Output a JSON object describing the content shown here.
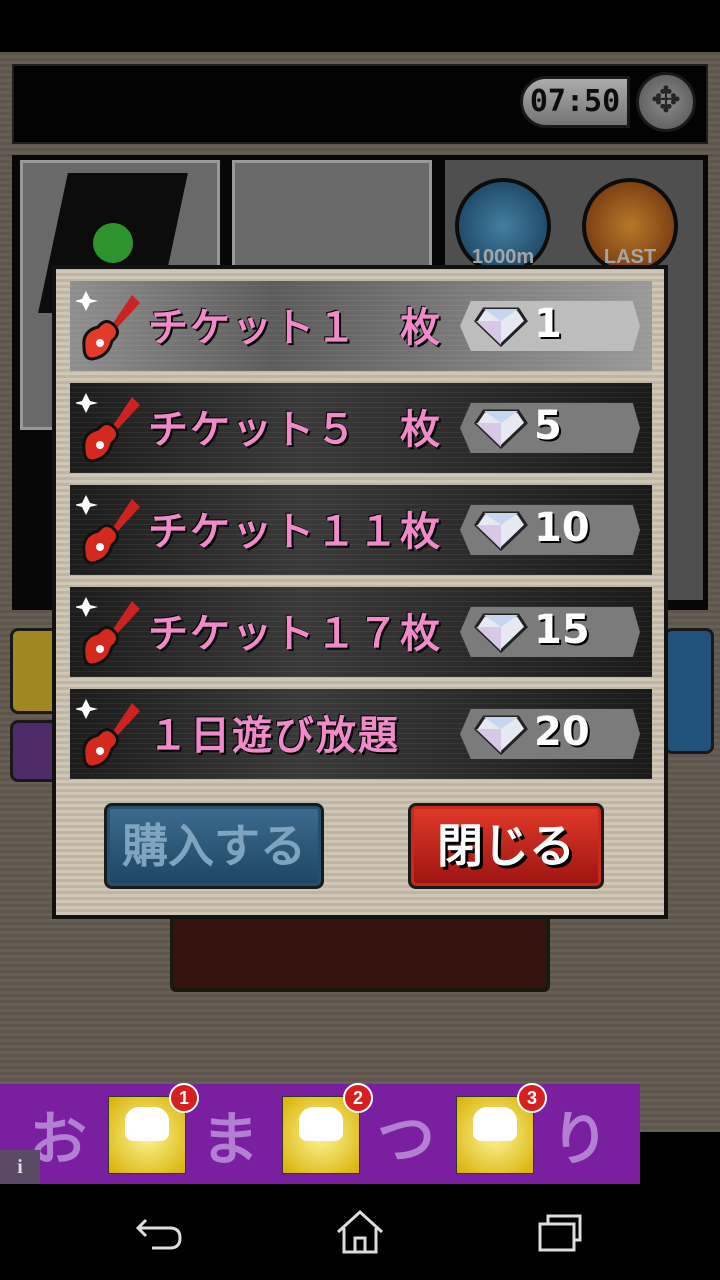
{
  "status": {
    "timer": "07:50"
  },
  "background": {
    "medals": [
      "1000m",
      "LAST"
    ],
    "start_button_label": ""
  },
  "shop_dialog": {
    "options": [
      {
        "label": "チケット１　枚",
        "price": "1",
        "selected": true
      },
      {
        "label": "チケット５　枚",
        "price": "5",
        "selected": false
      },
      {
        "label": "チケット１１枚",
        "price": "10",
        "selected": false
      },
      {
        "label": "チケット１７枚",
        "price": "15",
        "selected": false
      },
      {
        "label": "１日遊び放題",
        "price": "20",
        "selected": false
      }
    ],
    "buy_button": "購入する",
    "close_button": "閉じる"
  },
  "ad_banner": {
    "chars": [
      "お",
      "ま",
      "つ",
      "り"
    ],
    "badges": [
      "1",
      "2",
      "3"
    ],
    "info_icon": "i"
  },
  "icons": {
    "guitar": "guitar-icon",
    "gem": "diamond-icon",
    "settings": "settings-icon",
    "nav": [
      "back-icon",
      "home-icon",
      "recents-icon"
    ]
  },
  "colors": {
    "label_pink": "#f08ac8",
    "close_red": "#d42a1e",
    "buy_blue": "#2d5a7c",
    "ad_purple": "#7a1fa0"
  }
}
